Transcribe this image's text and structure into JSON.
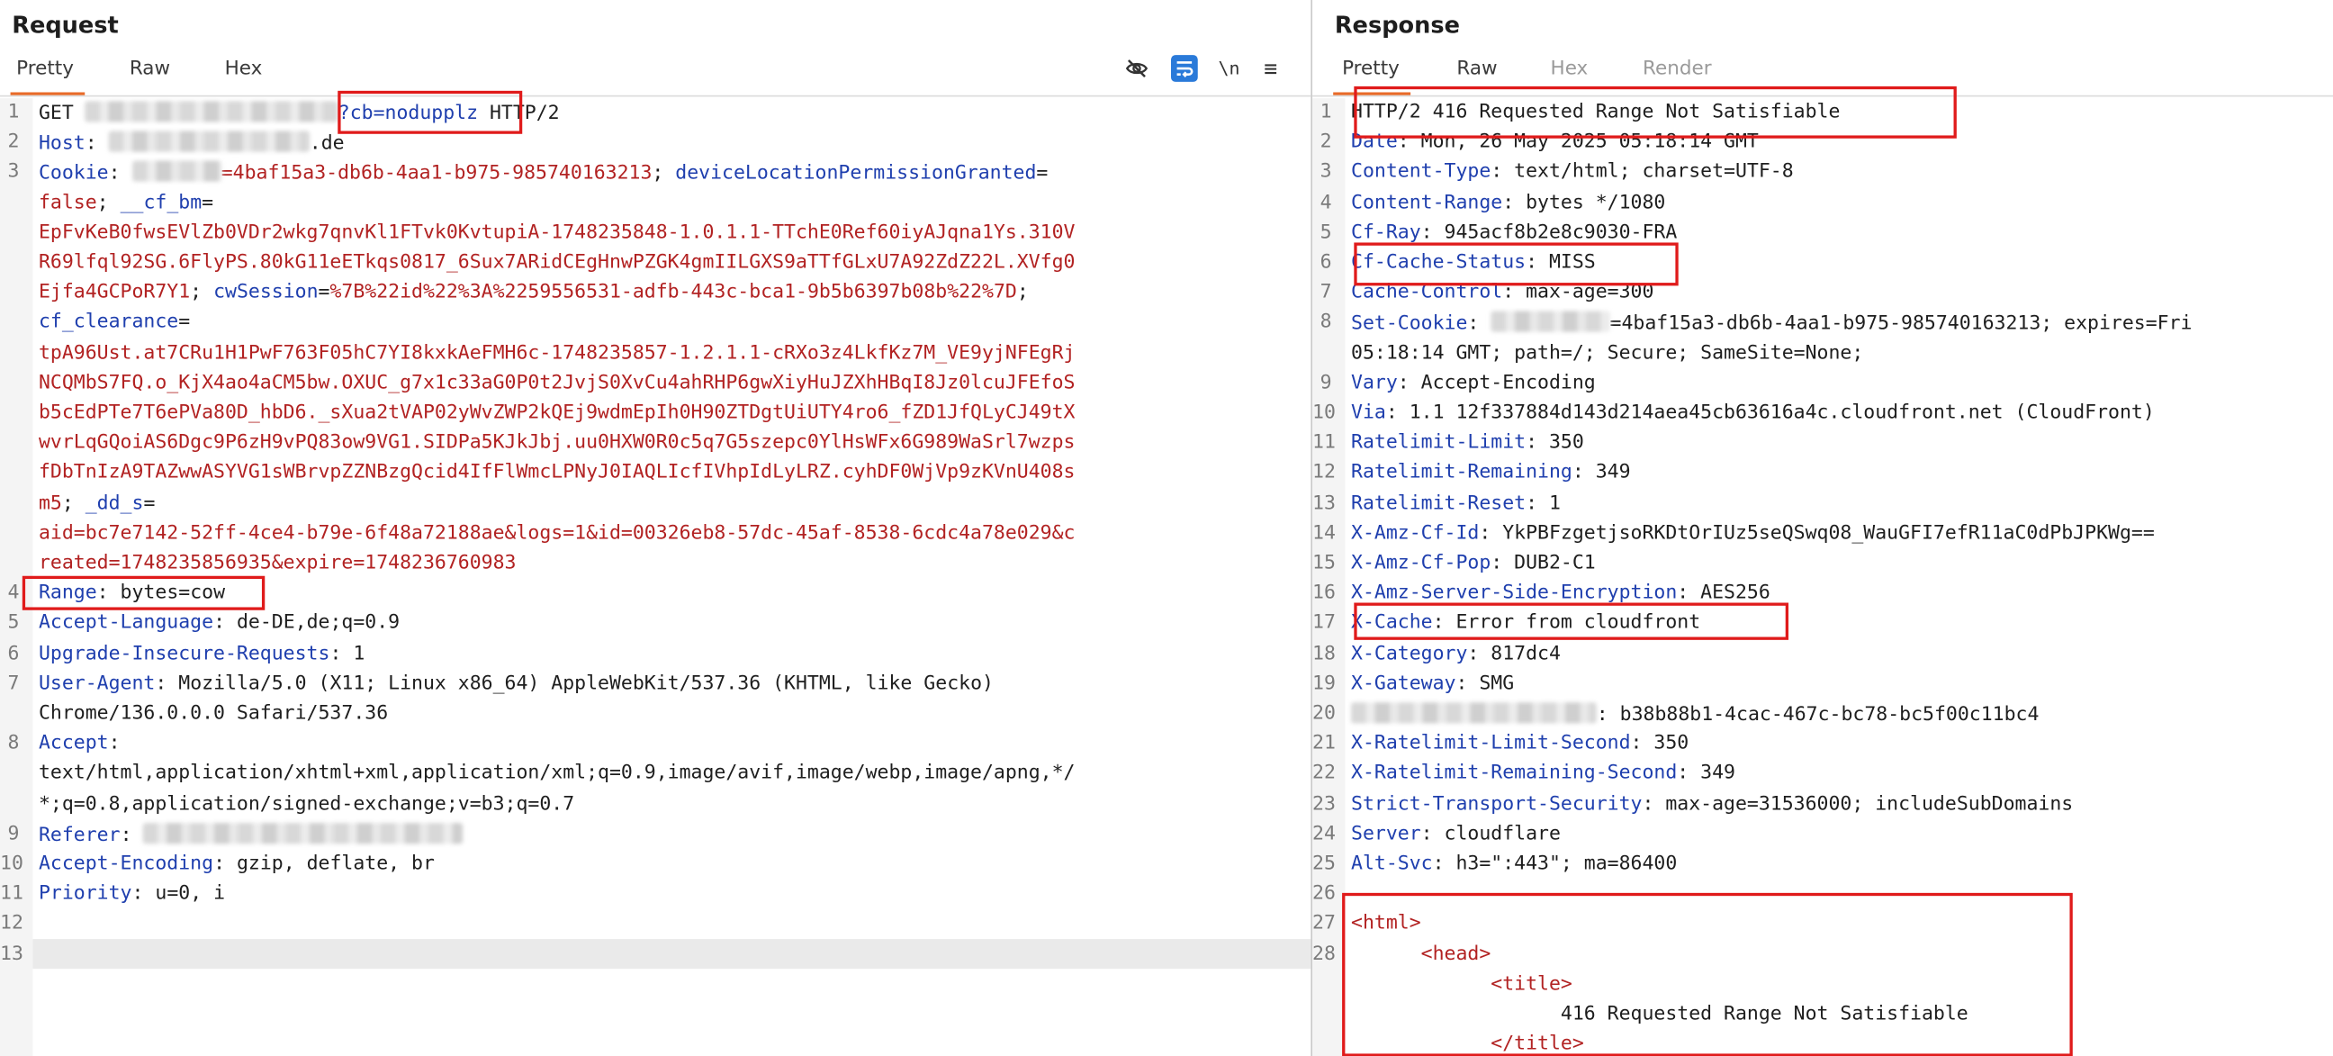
{
  "request": {
    "title": "Request",
    "tabs": [
      "Pretty",
      "Raw",
      "Hex"
    ],
    "active_tab": "Pretty",
    "toolbar_icons": [
      "eye-off-icon",
      "wrap-lines-icon",
      "newline-icon",
      "menu-icon"
    ],
    "newline_label": "\\n",
    "menu_label": "≡",
    "lines": [
      {
        "n": "1",
        "segs": [
          {
            "t": "GET "
          },
          {
            "blur": 170
          },
          {
            "t": "?cb=nodupplz",
            "c": "hdr"
          },
          {
            "t": " HTTP/2"
          }
        ]
      },
      {
        "n": "2",
        "segs": [
          {
            "t": "Host",
            "c": "hdr"
          },
          {
            "t": ": "
          },
          {
            "blur": 135
          },
          {
            "t": ".de"
          }
        ]
      },
      {
        "n": "3",
        "segs": [
          {
            "t": "Cookie",
            "c": "hdr"
          },
          {
            "t": ": "
          },
          {
            "blur": 60
          },
          {
            "t": "=4baf15a3-db6b-4aa1-b975-985740163213",
            "c": "red"
          },
          {
            "t": "; "
          },
          {
            "t": "deviceLocationPermissionGranted",
            "c": "hdr"
          },
          {
            "t": "="
          }
        ]
      },
      {
        "n": "",
        "segs": [
          {
            "t": "false",
            "c": "red"
          },
          {
            "t": "; "
          },
          {
            "t": "__cf_bm",
            "c": "hdr"
          },
          {
            "t": "="
          }
        ]
      },
      {
        "n": "",
        "segs": [
          {
            "t": "EpFvKeB0fwsEVlZb0VDr2wkg7qnvKl1FTvk0KvtupiA-1748235848-1.0.1.1-TTchE0Ref60iyAJqna1Ys.310V",
            "c": "red"
          }
        ]
      },
      {
        "n": "",
        "segs": [
          {
            "t": "R69lfql92SG.6FlyPS.80kG11eETkqs0817_6Sux7ARidCEgHnwPZGK4gmIILGXS9aTTfGLxU7A92ZdZ22L.XVfg0",
            "c": "red"
          }
        ]
      },
      {
        "n": "",
        "segs": [
          {
            "t": "Ejfa4GCPoR7Y1",
            "c": "red"
          },
          {
            "t": "; "
          },
          {
            "t": "cwSession",
            "c": "hdr"
          },
          {
            "t": "="
          },
          {
            "t": "%7B%22id%22%3A%2259556531-adfb-443c-bca1-9b5b6397b08b%22%7D",
            "c": "red"
          },
          {
            "t": ";"
          }
        ]
      },
      {
        "n": "",
        "segs": [
          {
            "t": "cf_clearance",
            "c": "hdr"
          },
          {
            "t": "="
          }
        ]
      },
      {
        "n": "",
        "segs": [
          {
            "t": "tpA96Ust.at7CRu1H1PwF763F05hC7YI8kxkAeFMH6c-1748235857-1.2.1.1-cRXo3z4LkfKz7M_VE9yjNFEgRj",
            "c": "red"
          }
        ]
      },
      {
        "n": "",
        "segs": [
          {
            "t": "NCQMbS7FQ.o_KjX4ao4aCM5bw.OXUC_g7x1c33aG0P0t2JvjS0XvCu4ahRHP6gwXiyHuJZXhHBqI8Jz0lcuJFEfoS",
            "c": "red"
          }
        ]
      },
      {
        "n": "",
        "segs": [
          {
            "t": "b5cEdPTe7T6ePVa80D_hbD6._sXua2tVAP02yWvZWP2kQEj9wdmEpIh0H90ZTDgtUiUTY4ro6_fZD1JfQLyCJ49tX",
            "c": "red"
          }
        ]
      },
      {
        "n": "",
        "segs": [
          {
            "t": "wvrLqGQoiAS6Dgc9P6zH9vPQ83ow9VG1.SIDPa5KJkJbj.uu0HXW0R0c5q7G5szepc0YlHsWFx6G989WaSrl7wzps",
            "c": "red"
          }
        ]
      },
      {
        "n": "",
        "segs": [
          {
            "t": "fDbTnIzA9TAZwwASYVG1sWBrvpZZNBzgQcid4IfFlWmcLPNyJ0IAQLIcfIVhpIdLyLRZ.cyhDF0WjVp9zKVnU408s",
            "c": "red"
          }
        ]
      },
      {
        "n": "",
        "segs": [
          {
            "t": "m5",
            "c": "red"
          },
          {
            "t": "; "
          },
          {
            "t": "_dd_s",
            "c": "hdr"
          },
          {
            "t": "="
          }
        ]
      },
      {
        "n": "",
        "segs": [
          {
            "t": "aid=bc7e7142-52ff-4ce4-b79e-6f48a72188ae&logs=1&id=00326eb8-57dc-45af-8538-6cdc4a78e029&c",
            "c": "red"
          }
        ]
      },
      {
        "n": "",
        "segs": [
          {
            "t": "reated=1748235856935&expire=1748236760983",
            "c": "red"
          }
        ]
      },
      {
        "n": "4",
        "segs": [
          {
            "t": "Range",
            "c": "hdr"
          },
          {
            "t": ": bytes=cow"
          }
        ]
      },
      {
        "n": "5",
        "segs": [
          {
            "t": "Accept-Language",
            "c": "hdr"
          },
          {
            "t": ": de-DE,de;q=0.9"
          }
        ]
      },
      {
        "n": "6",
        "segs": [
          {
            "t": "Upgrade-Insecure-Requests",
            "c": "hdr"
          },
          {
            "t": ": 1"
          }
        ]
      },
      {
        "n": "7",
        "segs": [
          {
            "t": "User-Agent",
            "c": "hdr"
          },
          {
            "t": ": Mozilla/5.0 (X11; Linux x86_64) AppleWebKit/537.36 (KHTML, like Gecko)"
          }
        ]
      },
      {
        "n": "",
        "segs": [
          {
            "t": "Chrome/136.0.0.0 Safari/537.36"
          }
        ]
      },
      {
        "n": "8",
        "segs": [
          {
            "t": "Accept",
            "c": "hdr"
          },
          {
            "t": ":"
          }
        ]
      },
      {
        "n": "",
        "segs": [
          {
            "t": "text/html,application/xhtml+xml,application/xml;q=0.9,image/avif,image/webp,image/apng,*/"
          }
        ]
      },
      {
        "n": "",
        "segs": [
          {
            "t": "*;q=0.8,application/signed-exchange;v=b3;q=0.7"
          }
        ]
      },
      {
        "n": "9",
        "segs": [
          {
            "t": "Referer",
            "c": "hdr"
          },
          {
            "t": ": "
          },
          {
            "blur": 215
          }
        ]
      },
      {
        "n": "10",
        "segs": [
          {
            "t": "Accept-Encoding",
            "c": "hdr"
          },
          {
            "t": ": gzip, deflate, br"
          }
        ]
      },
      {
        "n": "11",
        "segs": [
          {
            "t": "Priority",
            "c": "hdr"
          },
          {
            "t": ": u=0, i"
          }
        ]
      },
      {
        "n": "12",
        "segs": []
      },
      {
        "n": "13",
        "segs": []
      }
    ]
  },
  "response": {
    "title": "Response",
    "tabs": [
      "Pretty",
      "Raw",
      "Hex",
      "Render"
    ],
    "active_tab": "Pretty",
    "lines": [
      {
        "n": "1",
        "segs": [
          {
            "t": "HTTP/2 416 Requested Range Not Satisfiable"
          }
        ]
      },
      {
        "n": "2",
        "segs": [
          {
            "t": "Date",
            "c": "hdr"
          },
          {
            "t": ": Mon, 26 May 2025 05:18:14 GMT"
          }
        ]
      },
      {
        "n": "3",
        "segs": [
          {
            "t": "Content-Type",
            "c": "hdr"
          },
          {
            "t": ": text/html; charset=UTF-8"
          }
        ]
      },
      {
        "n": "4",
        "segs": [
          {
            "t": "Content-Range",
            "c": "hdr"
          },
          {
            "t": ": bytes */1080"
          }
        ]
      },
      {
        "n": "5",
        "segs": [
          {
            "t": "Cf-Ray",
            "c": "hdr"
          },
          {
            "t": ": 945acf8b2e8c9030-FRA"
          }
        ]
      },
      {
        "n": "6",
        "segs": [
          {
            "t": "Cf-Cache-Status",
            "c": "hdr"
          },
          {
            "t": ": MISS"
          }
        ]
      },
      {
        "n": "7",
        "segs": [
          {
            "t": "Cache-Control",
            "c": "hdr"
          },
          {
            "t": ": max-age=300"
          }
        ]
      },
      {
        "n": "8",
        "segs": [
          {
            "t": "Set-Cookie",
            "c": "hdr"
          },
          {
            "t": ": "
          },
          {
            "blur": 80
          },
          {
            "t": "=4baf15a3-db6b-4aa1-b975-985740163213; expires=Fri"
          }
        ]
      },
      {
        "n": "",
        "segs": [
          {
            "t": "05:18:14 GMT; path=/; Secure; SameSite=None;"
          }
        ]
      },
      {
        "n": "9",
        "segs": [
          {
            "t": "Vary",
            "c": "hdr"
          },
          {
            "t": ": Accept-Encoding"
          }
        ]
      },
      {
        "n": "10",
        "segs": [
          {
            "t": "Via",
            "c": "hdr"
          },
          {
            "t": ": 1.1 12f337884d143d214aea45cb63616a4c.cloudfront.net (CloudFront)"
          }
        ]
      },
      {
        "n": "11",
        "segs": [
          {
            "t": "Ratelimit-Limit",
            "c": "hdr"
          },
          {
            "t": ": 350"
          }
        ]
      },
      {
        "n": "12",
        "segs": [
          {
            "t": "Ratelimit-Remaining",
            "c": "hdr"
          },
          {
            "t": ": 349"
          }
        ]
      },
      {
        "n": "13",
        "segs": [
          {
            "t": "Ratelimit-Reset",
            "c": "hdr"
          },
          {
            "t": ": 1"
          }
        ]
      },
      {
        "n": "14",
        "segs": [
          {
            "t": "X-Amz-Cf-Id",
            "c": "hdr"
          },
          {
            "t": ": YkPBFzgetjsoRKDtOrIUz5seQSwq08_WauGFI7efR11aC0dPbJPKWg=="
          }
        ]
      },
      {
        "n": "15",
        "segs": [
          {
            "t": "X-Amz-Cf-Pop",
            "c": "hdr"
          },
          {
            "t": ": DUB2-C1"
          }
        ]
      },
      {
        "n": "16",
        "segs": [
          {
            "t": "X-Amz-Server-Side-Encryption",
            "c": "hdr"
          },
          {
            "t": ": AES256"
          }
        ]
      },
      {
        "n": "17",
        "segs": [
          {
            "t": "X-Cache",
            "c": "hdr"
          },
          {
            "t": ": Error from cloudfront"
          }
        ]
      },
      {
        "n": "18",
        "segs": [
          {
            "t": "X-Category",
            "c": "hdr"
          },
          {
            "t": ": 817dc4"
          }
        ]
      },
      {
        "n": "19",
        "segs": [
          {
            "t": "X-Gateway",
            "c": "hdr"
          },
          {
            "t": ": SMG"
          }
        ]
      },
      {
        "n": "20",
        "segs": [
          {
            "blur": 165
          },
          {
            "t": ": b38b88b1-4cac-467c-bc78-bc5f00c11bc4"
          }
        ]
      },
      {
        "n": "21",
        "segs": [
          {
            "t": "X-Ratelimit-Limit-Second",
            "c": "hdr"
          },
          {
            "t": ": 350"
          }
        ]
      },
      {
        "n": "22",
        "segs": [
          {
            "t": "X-Ratelimit-Remaining-Second",
            "c": "hdr"
          },
          {
            "t": ": 349"
          }
        ]
      },
      {
        "n": "23",
        "segs": [
          {
            "t": "Strict-Transport-Security",
            "c": "hdr"
          },
          {
            "t": ": max-age=31536000; includeSubDomains"
          }
        ]
      },
      {
        "n": "24",
        "segs": [
          {
            "t": "Server",
            "c": "hdr"
          },
          {
            "t": ": cloudflare"
          }
        ]
      },
      {
        "n": "25",
        "segs": [
          {
            "t": "Alt-Svc",
            "c": "hdr"
          },
          {
            "t": ": h3=\":443\"; ma=86400"
          }
        ]
      },
      {
        "n": "26",
        "segs": []
      },
      {
        "n": "27",
        "segs": [
          {
            "t": "<html>",
            "c": "red"
          }
        ]
      },
      {
        "n": "28",
        "segs": [
          {
            "t": "      "
          },
          {
            "t": "<head>",
            "c": "red"
          }
        ]
      },
      {
        "n": "",
        "segs": [
          {
            "t": "            "
          },
          {
            "t": "<title>",
            "c": "red"
          }
        ]
      },
      {
        "n": "",
        "segs": [
          {
            "t": "                  416 Requested Range Not Satisfiable"
          }
        ]
      },
      {
        "n": "",
        "segs": [
          {
            "t": "            "
          },
          {
            "t": "</title>",
            "c": "red"
          }
        ]
      }
    ]
  },
  "colors": {
    "header_name": "#1f3fae",
    "value_red": "#b22222",
    "highlight_box": "#e01b1b",
    "active_tab_underline": "#e86b2a",
    "active_icon_bg": "#2a7ad9"
  }
}
